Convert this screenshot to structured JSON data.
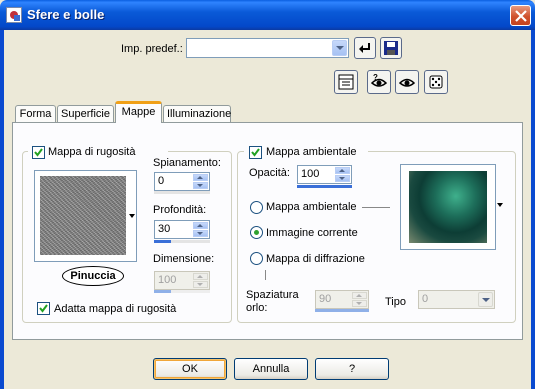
{
  "window": {
    "title": "Sfere e bolle"
  },
  "presets": {
    "label": "Imp. predef.:",
    "value": ""
  },
  "toolbar": {
    "row1": [
      "reset-arrow-icon",
      "save-disk-icon"
    ],
    "row2": [
      "settings-grid-icon",
      "eye-question-icon",
      "eye-icon",
      "dice-icon"
    ]
  },
  "tabs": [
    {
      "label": "Forma"
    },
    {
      "label": "Superficie"
    },
    {
      "label": "Mappe",
      "active": true
    },
    {
      "label": "Illuminazione"
    }
  ],
  "bump": {
    "enabled_label": "Mappa di rugosità",
    "enabled": true,
    "preview_caption": "Pinuccia",
    "smoothing": {
      "label": "Spianamento:",
      "value": "0",
      "level": 0
    },
    "depth": {
      "label": "Profondità:",
      "value": "30",
      "level": 0.3
    },
    "size": {
      "label": "Dimensione:",
      "value": "100",
      "level": 0.3,
      "disabled": true
    },
    "fit_label": "Adatta mappa di rugosità",
    "fit": true
  },
  "env": {
    "enabled_label": "Mappa ambientale",
    "enabled": true,
    "opacity": {
      "label": "Opacità:",
      "value": "100",
      "level": 1
    },
    "options": [
      {
        "label": "Mappa ambientale",
        "selected": false
      },
      {
        "label": "Immagine corrente",
        "selected": true
      },
      {
        "label": "Mappa di diffrazione",
        "selected": false
      }
    ],
    "spacing": {
      "label": "Spaziatura orlo:",
      "value": "90",
      "level": 1,
      "disabled": true
    },
    "type": {
      "label": "Tipo",
      "value": "0",
      "disabled": true
    }
  },
  "buttons": {
    "ok": "OK",
    "cancel": "Annulla",
    "help": "?"
  },
  "colors": {
    "title_bar": "#0a5ad8",
    "dialog_bg": "#ece9d8",
    "tab_accent": "#f0a018",
    "level_fill": "#3a6fd8",
    "radio_on": "#2ea12e"
  }
}
